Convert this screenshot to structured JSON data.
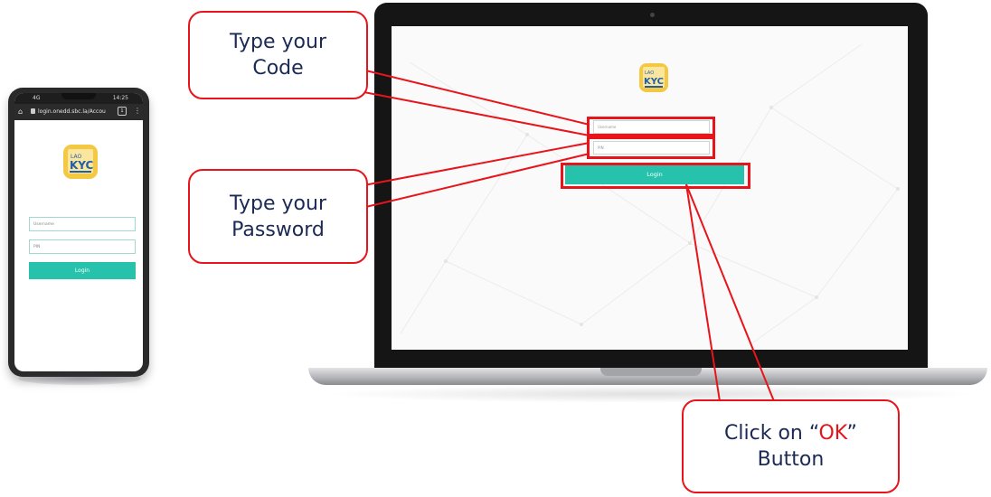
{
  "phone": {
    "status_left": "4G",
    "status_right": "14:25",
    "url": "login.onedd.sbc.la/Accou",
    "tab_count": "1",
    "logo_top": "LAO",
    "logo_main": "KYC",
    "username_placeholder": "Username",
    "pin_placeholder": "PIN",
    "login_label": "Login"
  },
  "laptop": {
    "logo_top": "LAO",
    "logo_main": "KYC",
    "username_placeholder": "Username",
    "pin_placeholder": "PIN",
    "login_label": "Login"
  },
  "callouts": {
    "code_line1": "Type your",
    "code_line2": "Code",
    "password_line1": "Type your",
    "password_line2": "Password",
    "ok_prefix": "Click on “",
    "ok_word": "OK",
    "ok_suffix": "”",
    "ok_line2": "Button"
  },
  "colors": {
    "accent_red": "#e8141b",
    "button_teal": "#26c2ab",
    "callout_text": "#1b2a55",
    "logo_yellow": "#f5c842"
  }
}
